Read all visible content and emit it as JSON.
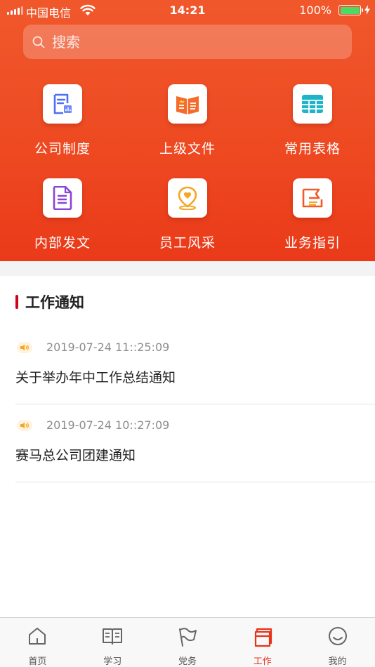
{
  "status_bar": {
    "carrier": "中国电信",
    "time": "14:21",
    "battery": "100%"
  },
  "search": {
    "placeholder": "搜索"
  },
  "grid": [
    {
      "label": "公司制度"
    },
    {
      "label": "上级文件"
    },
    {
      "label": "常用表格"
    },
    {
      "label": "内部发文"
    },
    {
      "label": "员工风采"
    },
    {
      "label": "业务指引"
    }
  ],
  "section": {
    "title": "工作通知"
  },
  "notices": [
    {
      "time": "2019-07-24 11::25:09",
      "title": "关于举办年中工作总结通知"
    },
    {
      "time": "2019-07-24 10::27:09",
      "title": "赛马总公司团建通知"
    }
  ],
  "tabs": [
    {
      "label": "首页"
    },
    {
      "label": "学习"
    },
    {
      "label": "党务"
    },
    {
      "label": "工作"
    },
    {
      "label": "我的"
    }
  ],
  "colors": {
    "header": "#ee4a22",
    "accent": "#e8321a",
    "section_bar": "#d0021b"
  }
}
